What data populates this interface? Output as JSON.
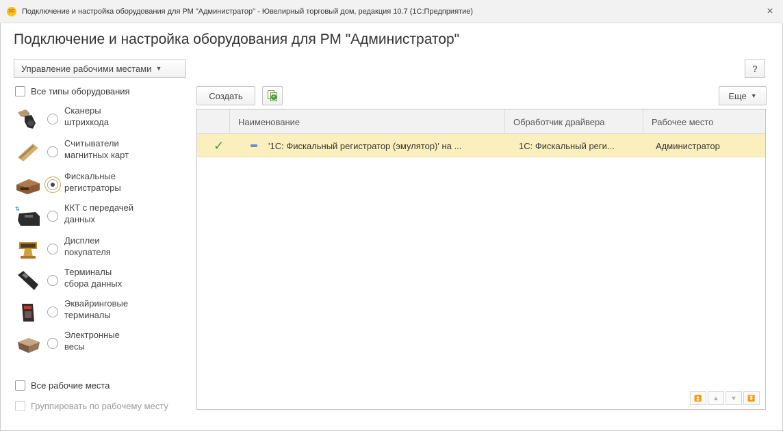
{
  "window": {
    "app_icon_text": "1С",
    "title": "Подключение и настройка оборудования для РМ \"Администратор\" - Ювелирный торговый дом, редакция 10.7  (1С:Предприятие)",
    "close_symbol": "×"
  },
  "form": {
    "title": "Подключение и настройка оборудования для РМ \"Администратор\"",
    "workplaces_menu_label": "Управление рабочими местами",
    "help_label": "?"
  },
  "filters": {
    "all_types_label": "Все типы оборудования",
    "all_types_checked": false,
    "all_workplaces_label": "Все рабочие места",
    "group_by_workplace_label": "Группировать по рабочему месту"
  },
  "equipment_types": [
    {
      "line1": "Сканеры",
      "line2": "штрихкода",
      "icon": "barcode-scanner-icon",
      "selected": false
    },
    {
      "line1": "Считыватели",
      "line2": "магнитных карт",
      "icon": "card-reader-icon",
      "selected": false
    },
    {
      "line1": "Фискальные",
      "line2": "регистраторы",
      "icon": "fiscal-register-icon",
      "selected": true
    },
    {
      "line1": "ККТ с передачей",
      "line2": "данных",
      "icon": "online-cash-register-icon",
      "selected": false
    },
    {
      "line1": "Дисплеи",
      "line2": "покупателя",
      "icon": "customer-display-icon",
      "selected": false
    },
    {
      "line1": "Терминалы",
      "line2": "сбора данных",
      "icon": "data-terminal-icon",
      "selected": false
    },
    {
      "line1": "Эквайринговые",
      "line2": "терминалы",
      "icon": "acquiring-terminal-icon",
      "selected": false
    },
    {
      "line1": "Электронные",
      "line2": "весы",
      "icon": "scales-icon",
      "selected": false
    }
  ],
  "toolbar": {
    "create_label": "Создать",
    "more_label": "Еще"
  },
  "table": {
    "columns": [
      "Наименование",
      "Обработчик драйвера",
      "Рабочее место"
    ],
    "rows": [
      {
        "active": true,
        "name": "'1С: Фискальный регистратор (эмулятор)' на ...",
        "driver": "1С: Фискальный реги...",
        "workplace": "Администратор"
      }
    ],
    "nav_symbols": [
      "⏫",
      "▲",
      "▼",
      "⏬"
    ]
  },
  "colors": {
    "selected_row": "#fbf0bd",
    "header_bg": "#f2f2f2",
    "check_green": "#3a9a3a",
    "focus_border": "#d2a84a"
  }
}
